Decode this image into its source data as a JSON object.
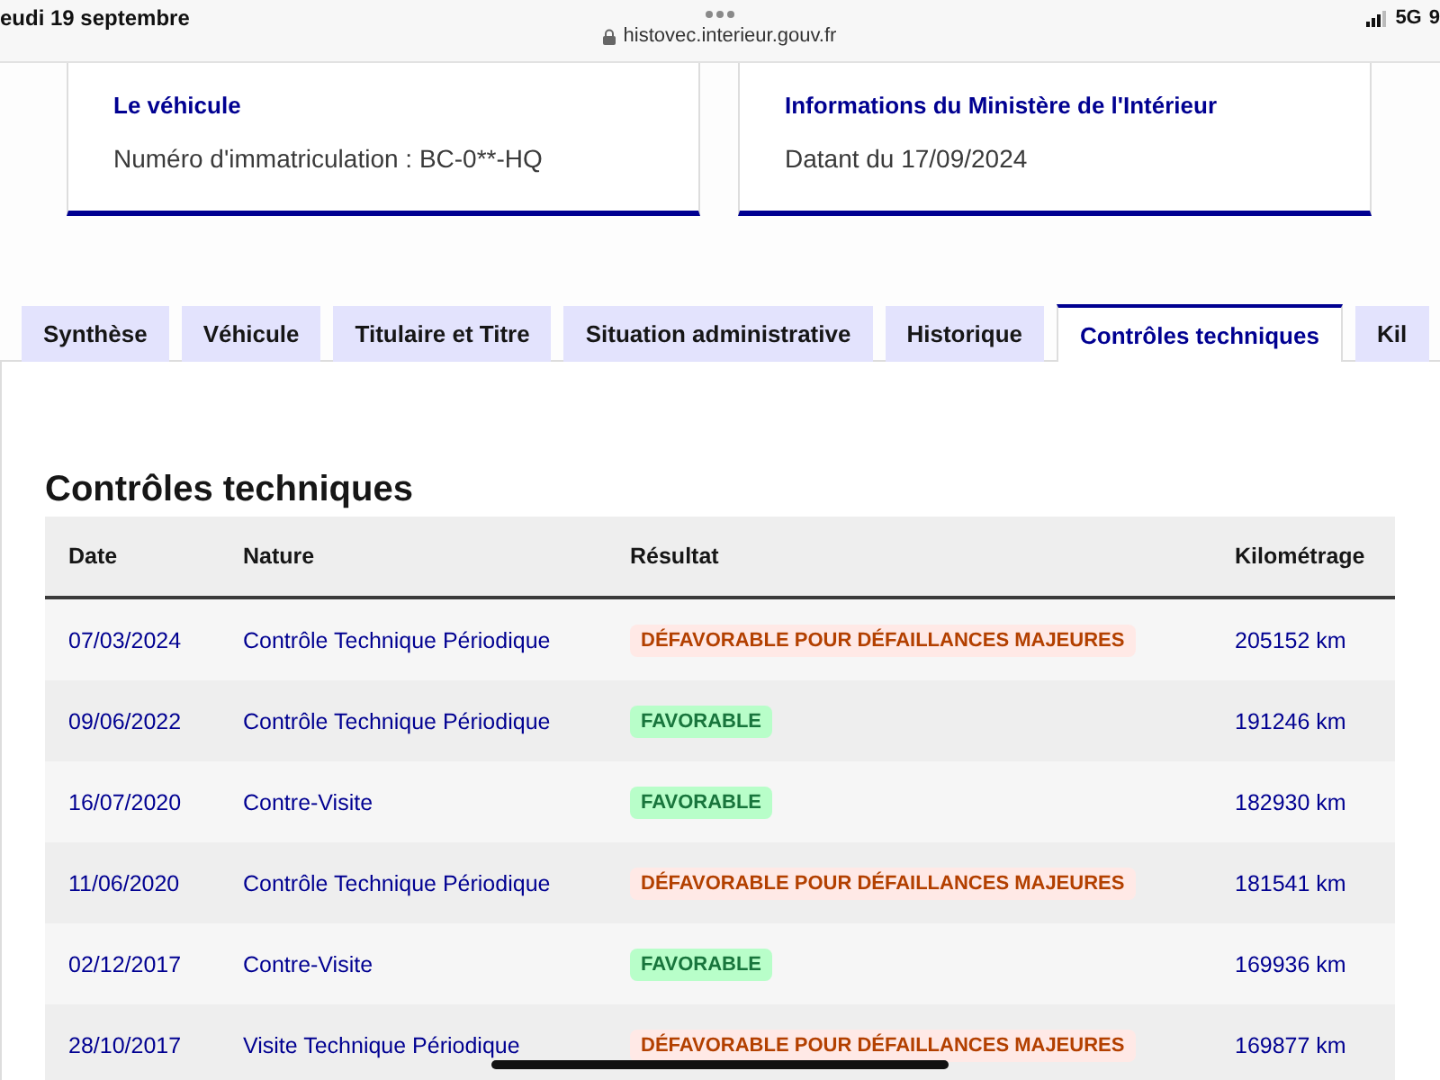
{
  "status_bar": {
    "date": "eudi 19 septembre",
    "url": "histovec.interieur.gouv.fr",
    "network": "5G",
    "battery": "9"
  },
  "cards": [
    {
      "title": "Le véhicule",
      "text": "Numéro d'immatriculation : BC-0**-HQ"
    },
    {
      "title": "Informations du Ministère de l'Intérieur",
      "text": "Datant du 17/09/2024"
    }
  ],
  "tabs": [
    {
      "label": "Synthèse",
      "selected": false
    },
    {
      "label": "Véhicule",
      "selected": false
    },
    {
      "label": "Titulaire et Titre",
      "selected": false
    },
    {
      "label": "Situation administrative",
      "selected": false
    },
    {
      "label": "Historique",
      "selected": false
    },
    {
      "label": "Contrôles techniques",
      "selected": true
    },
    {
      "label": "Kil",
      "selected": false
    }
  ],
  "section": {
    "title": "Contrôles techniques"
  },
  "table": {
    "columns": [
      "Date",
      "Nature",
      "Résultat",
      "Kilométrage"
    ],
    "rows": [
      {
        "date": "07/03/2024",
        "nature": "Contrôle Technique Périodique",
        "result": {
          "label": "DÉFAVORABLE POUR DÉFAILLANCES MAJEURES",
          "kind": "unfavorable"
        },
        "mileage": "205152 km"
      },
      {
        "date": "09/06/2022",
        "nature": "Contrôle Technique Périodique",
        "result": {
          "label": "FAVORABLE",
          "kind": "favorable"
        },
        "mileage": "191246 km"
      },
      {
        "date": "16/07/2020",
        "nature": "Contre-Visite",
        "result": {
          "label": "FAVORABLE",
          "kind": "favorable"
        },
        "mileage": "182930 km"
      },
      {
        "date": "11/06/2020",
        "nature": "Contrôle Technique Périodique",
        "result": {
          "label": "DÉFAVORABLE POUR DÉFAILLANCES MAJEURES",
          "kind": "unfavorable"
        },
        "mileage": "181541 km"
      },
      {
        "date": "02/12/2017",
        "nature": "Contre-Visite",
        "result": {
          "label": "FAVORABLE",
          "kind": "favorable"
        },
        "mileage": "169936 km"
      },
      {
        "date": "28/10/2017",
        "nature": "Visite Technique Périodique",
        "result": {
          "label": "DÉFAVORABLE POUR DÉFAILLANCES MAJEURES",
          "kind": "unfavorable"
        },
        "mileage": "169877 km"
      }
    ]
  }
}
